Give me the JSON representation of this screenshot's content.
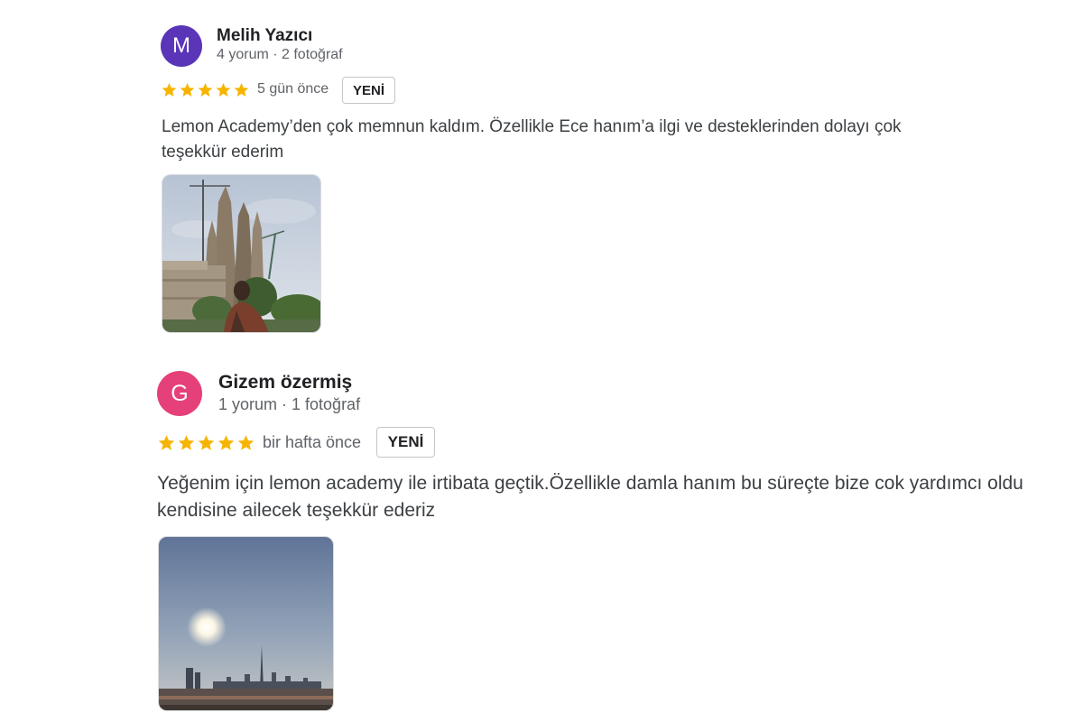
{
  "reviews": [
    {
      "initial": "M",
      "avatar_color": "#5b35b8",
      "name": "Melih Yazıcı",
      "meta": "4 yorum · 2 fotoğraf",
      "rating": 5,
      "time": "5 gün önce",
      "badge": "YENİ",
      "text": "Lemon Academy’den çok memnun kaldım. Özellikle Ece hanım’a ilgi ve desteklerinden dolayı çok teşekkür ederim",
      "photo_icon": "cathedral-photo"
    },
    {
      "initial": "G",
      "avatar_color": "#e5407a",
      "name": "Gizem özermiş",
      "meta": "1 yorum · 1 fotoğraf",
      "rating": 5,
      "time": "bir hafta önce",
      "badge": "YENİ",
      "text": "Yeğenim için lemon academy ile irtibata geçtik.Özellikle damla hanım bu süreçte bize cok yardımcı oldu kendisine ailecek teşekkür ederiz",
      "photo_icon": "skyline-photo"
    }
  ],
  "colors": {
    "star": "#f6b400"
  }
}
